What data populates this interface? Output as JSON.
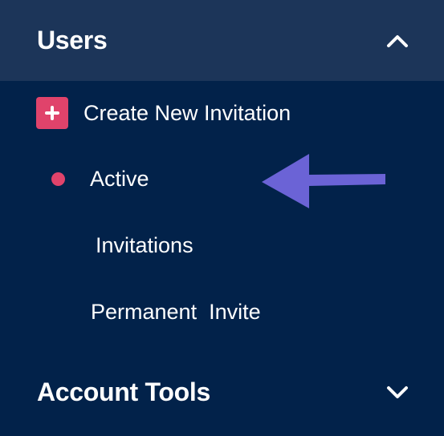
{
  "colors": {
    "sidebar_bg": "#02224a",
    "header_bg": "#1c3559",
    "accent_pink": "#e0436b",
    "annotation_arrow": "#6b63d6",
    "text": "#ffffff"
  },
  "users_section": {
    "title": "Users",
    "state": "expanded",
    "toggle_icon": "chevron-up-icon",
    "items": [
      {
        "label": "Create New Invitation",
        "icon": "plus-icon"
      },
      {
        "label": "Active",
        "icon": "dot-icon",
        "active": true
      },
      {
        "label": "Invitations"
      },
      {
        "label": "Permanent  Invite"
      }
    ]
  },
  "account_tools_section": {
    "title": "Account Tools",
    "state": "collapsed",
    "toggle_icon": "chevron-down-icon"
  },
  "annotation": {
    "icon": "arrow-left-icon",
    "points_to": "Active"
  }
}
